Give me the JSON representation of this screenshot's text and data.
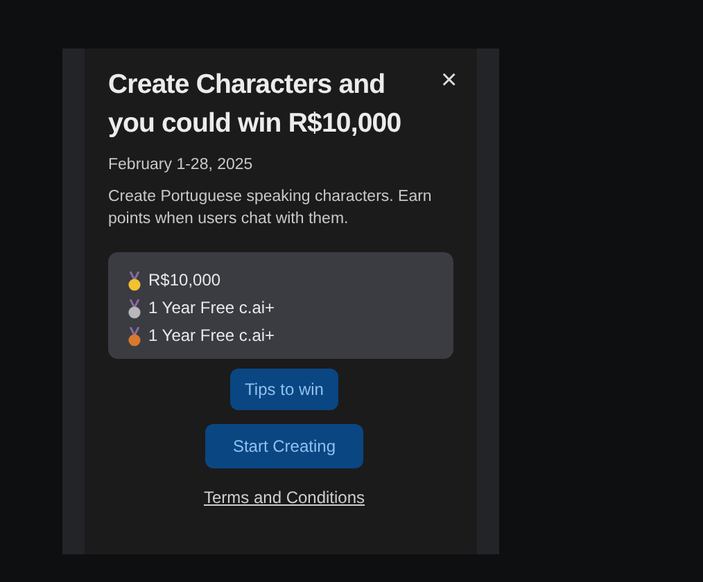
{
  "dialog": {
    "title": "Create Characters and you could win R$10,000",
    "close": "×",
    "date": "February 1-28, 2025",
    "description": "Create Portuguese speaking characters. Earn points when users chat with them.",
    "prizes": [
      {
        "label": "R$10,000",
        "color": "#f2c230"
      },
      {
        "label": "1 Year Free c.ai+",
        "color": "#b8b8bc"
      },
      {
        "label": "1 Year Free c.ai+",
        "color": "#d9782e"
      }
    ],
    "buttons": [
      {
        "label": "Tips to win"
      },
      {
        "label": "Start Creating"
      }
    ],
    "link": "Terms and Conditions"
  }
}
